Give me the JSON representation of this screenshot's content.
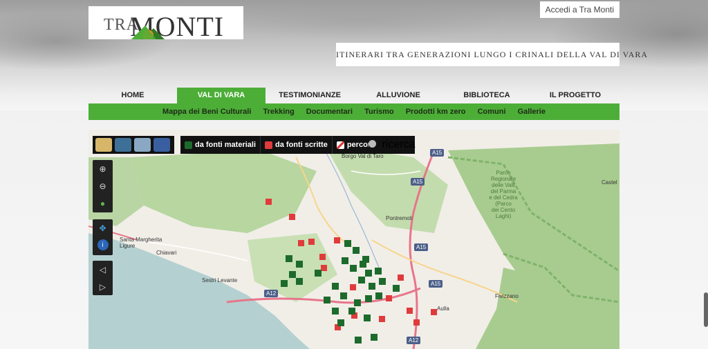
{
  "header": {
    "logo": {
      "prefix": "TRA",
      "name": "MONTI"
    },
    "login_link": "Accedi a Tra Monti",
    "tagline": "ITINERARI TRA GENERAZIONI LUNGO I CRINALI DELLA VAL DI VARA"
  },
  "nav": {
    "items": [
      "HOME",
      "VAL DI VARA",
      "TESTIMONIANZE",
      "ALLUVIONE",
      "BIBLIOTECA",
      "IL PROGETTO"
    ],
    "active": "VAL DI VARA"
  },
  "subnav": {
    "items": [
      "Mappa dei Beni Culturali",
      "Trekking",
      "Documentari",
      "Turismo",
      "Prodotti km zero",
      "Comuni",
      "Gallerie"
    ]
  },
  "map": {
    "toolbar": {
      "layers": [
        "da fonti materiali",
        "da fonti scritte",
        "percorsi"
      ],
      "search": "ricerca"
    },
    "sidebar_icons": [
      "zoom-in-icon",
      "zoom-out-icon",
      "globe-icon",
      "pan-icon",
      "info-icon",
      "zoom-prev-icon",
      "zoom-next-icon"
    ],
    "place_labels": [
      "Borgo Val di Taro",
      "Pontremoli",
      "Santa Margherita Ligure",
      "Chiavari",
      "Sestri Levante",
      "Aulla",
      "Fivizzano",
      "Castel"
    ],
    "park_label": [
      "Parco",
      "Regionale",
      "delle Valli",
      "del Parma",
      "e del Cedra",
      "(Parco",
      "dei Cento",
      "Laghi)"
    ],
    "road_shields": [
      "A15",
      "A15",
      "A15",
      "A15",
      "A12",
      "A12"
    ],
    "colors": {
      "forest": "#a8cc8f",
      "park_border": "#7fb26a",
      "highway": "#e7758a",
      "sea": "#b5d0d0",
      "land": "#f1eee8",
      "marker_green": "#1d6b2c",
      "marker_red": "#e03b3b"
    }
  }
}
